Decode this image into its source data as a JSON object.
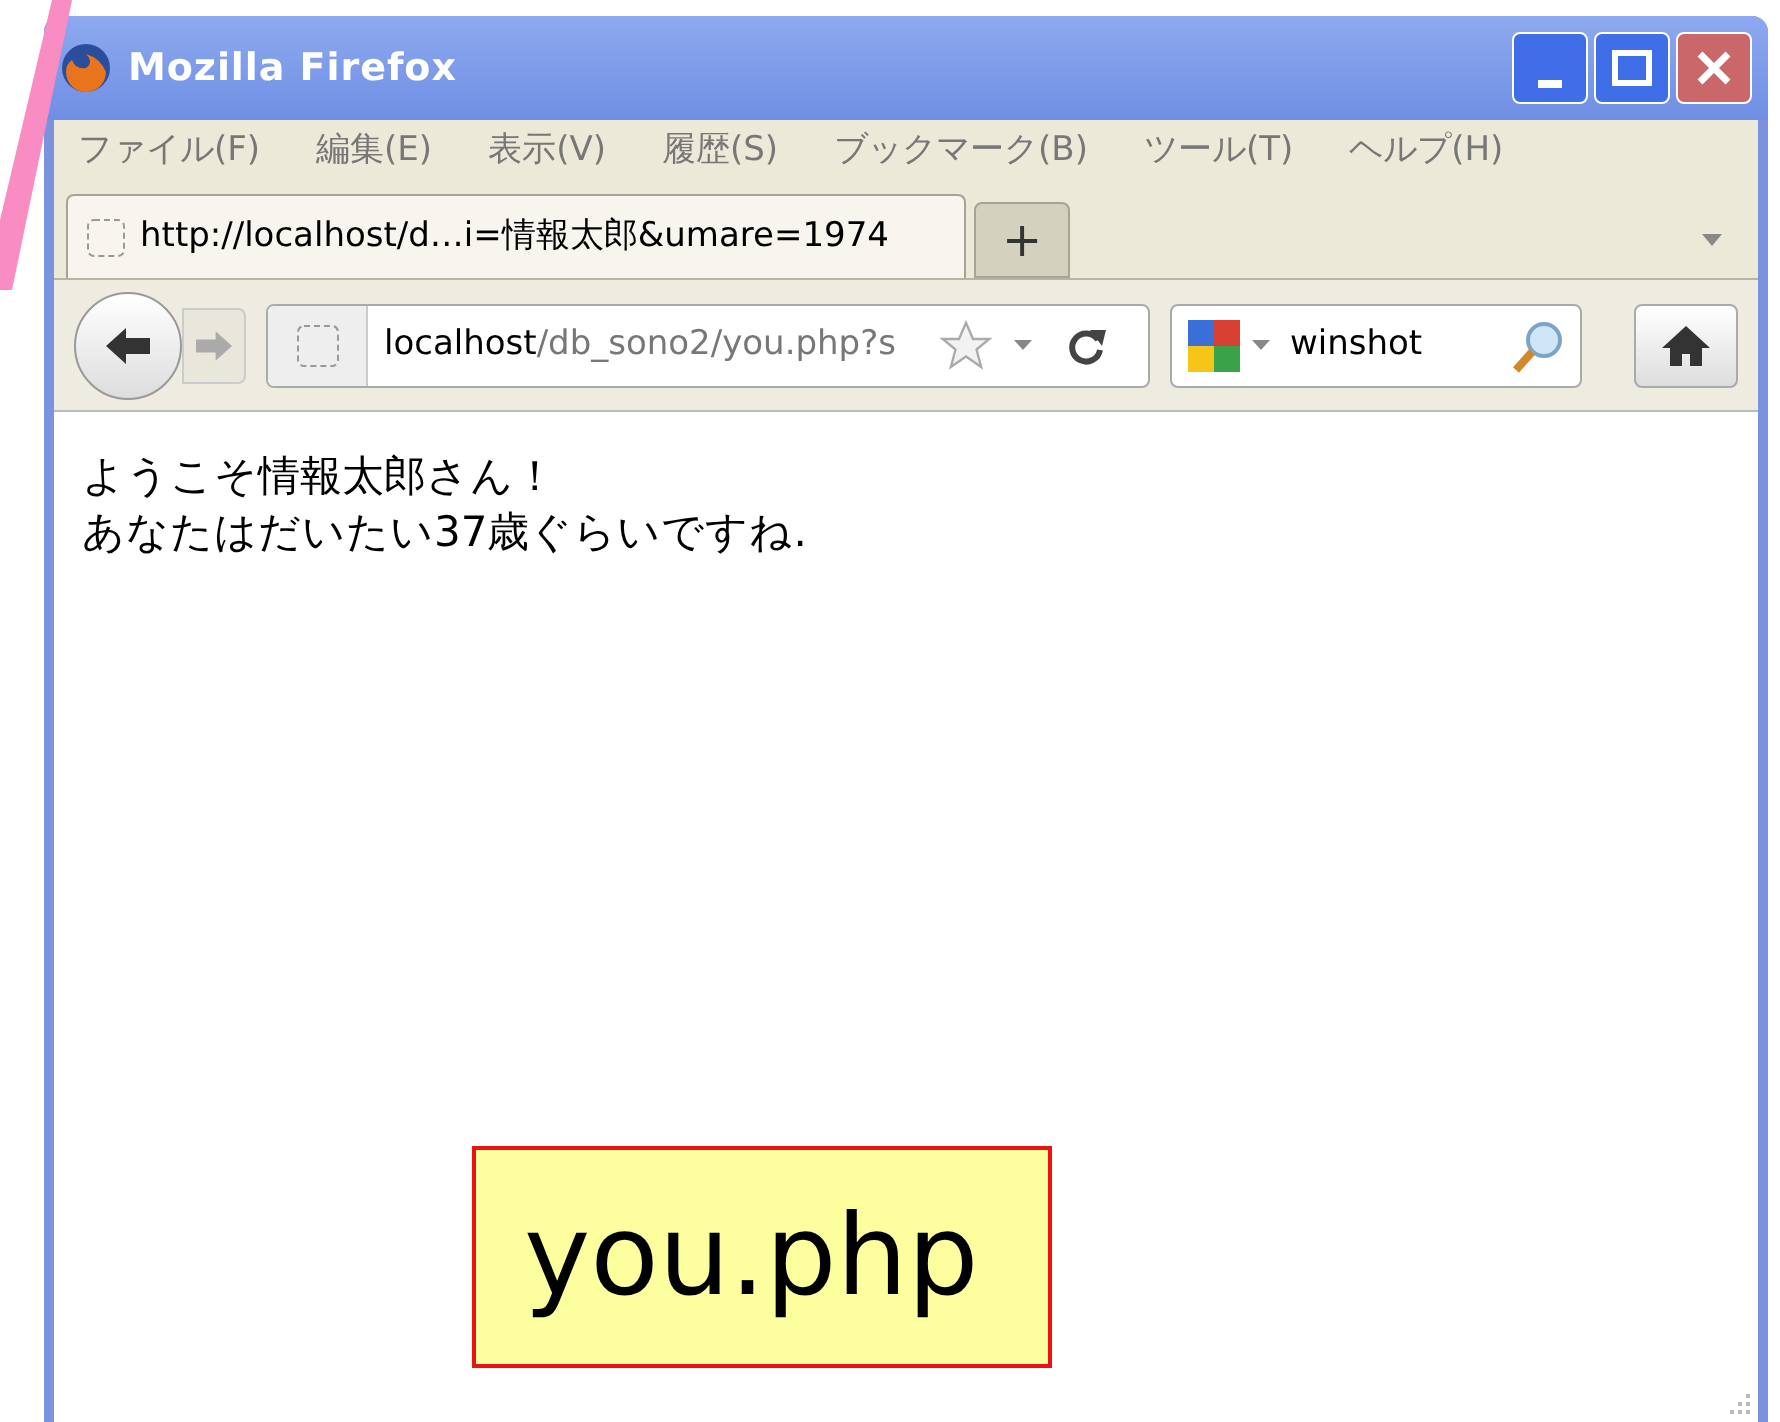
{
  "window": {
    "title": "Mozilla Firefox"
  },
  "menu": [
    "ファイル(F)",
    "編集(E)",
    "表示(V)",
    "履歴(S)",
    "ブックマーク(B)",
    "ツール(T)",
    "ヘルプ(H)"
  ],
  "tabs": [
    {
      "label": "http://localhost/d…i=情報太郎&umare=1974",
      "selected": true
    }
  ],
  "new_tab": "+",
  "address_bar": {
    "host": "localhost",
    "path": "/db_sono2/you.php?s"
  },
  "search": {
    "value": "winshot"
  },
  "content": {
    "lines": [
      "ようこそ情報太郎さん！",
      "あなたはだいたい37歳ぐらいですね."
    ]
  },
  "callout": "you.php"
}
